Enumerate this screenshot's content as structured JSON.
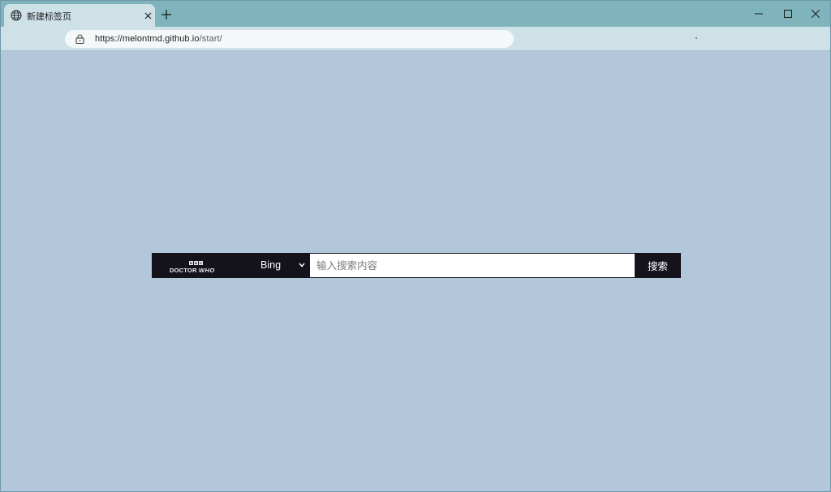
{
  "browser": {
    "tab": {
      "title": "新建标签页",
      "icon": "globe-icon"
    },
    "address": {
      "url_domain": "https://melontmd.github.io",
      "url_path": "/start/"
    },
    "window_controls": [
      "minimize",
      "maximize",
      "close"
    ]
  },
  "page": {
    "logo": {
      "brand_blocks": [
        "B",
        "B",
        "C"
      ],
      "text_main": "DOCTOR",
      "text_accent": "WHO"
    },
    "search": {
      "engine_selected": "Bing",
      "placeholder": "输入搜索内容",
      "value": "",
      "button_label": "搜索"
    }
  },
  "colors": {
    "background": "#b2c8da",
    "tabstrip": "#7fb4bc",
    "toolbar": "#cde1e6",
    "search_dark": "#14131c"
  }
}
